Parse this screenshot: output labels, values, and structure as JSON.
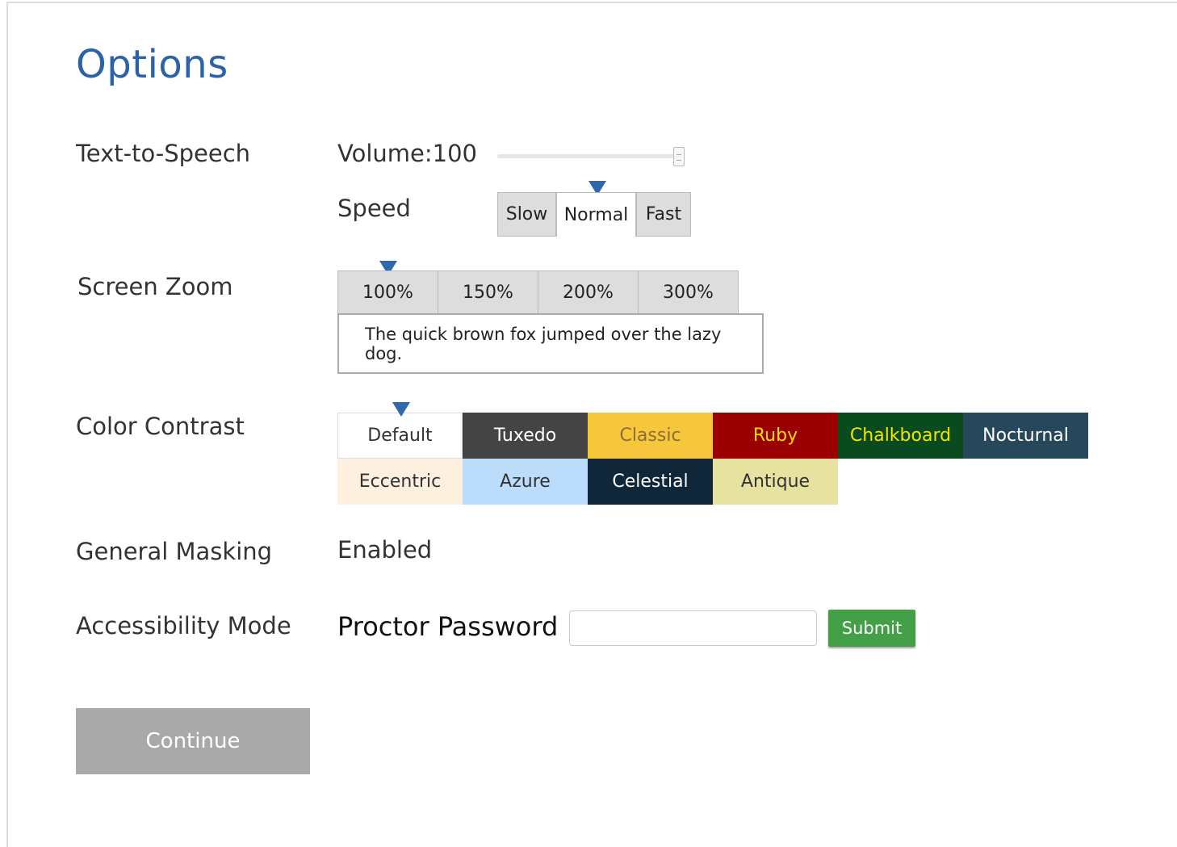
{
  "page": {
    "title": "Options"
  },
  "tts": {
    "label": "Text-to-Speech",
    "volume_label": "Volume:100",
    "volume_value": 100,
    "speed_label": "Speed",
    "speed_options": [
      "Slow",
      "Normal",
      "Fast"
    ],
    "speed_selected": "Normal"
  },
  "zoom": {
    "label": "Screen Zoom",
    "options": [
      "100%",
      "150%",
      "200%",
      "300%"
    ],
    "selected": "100%",
    "sample_text": "The quick brown fox jumped over the lazy dog."
  },
  "contrast": {
    "label": "Color Contrast",
    "selected": "Default",
    "themes": [
      {
        "name": "Default",
        "bg": "#ffffff",
        "fg": "#333333"
      },
      {
        "name": "Tuxedo",
        "bg": "#444444",
        "fg": "#ffffff"
      },
      {
        "name": "Classic",
        "bg": "#f6c73b",
        "fg": "#8a6d3b"
      },
      {
        "name": "Ruby",
        "bg": "#9b0000",
        "fg": "#ffdd00"
      },
      {
        "name": "Chalkboard",
        "bg": "#094a1e",
        "fg": "#f2e400"
      },
      {
        "name": "Nocturnal",
        "bg": "#27485a",
        "fg": "#ffffff"
      },
      {
        "name": "Eccentric",
        "bg": "#fdf0df",
        "fg": "#333333"
      },
      {
        "name": "Azure",
        "bg": "#bcdcfc",
        "fg": "#333333"
      },
      {
        "name": "Celestial",
        "bg": "#10273a",
        "fg": "#ffffff"
      },
      {
        "name": "Antique",
        "bg": "#e8e2a0",
        "fg": "#333333"
      }
    ]
  },
  "masking": {
    "label": "General Masking",
    "value": "Enabled"
  },
  "accessibility": {
    "label": "Accessibility Mode",
    "password_label": "Proctor Password",
    "password_value": "",
    "submit_label": "Submit"
  },
  "continue_label": "Continue",
  "colors": {
    "title": "#2b62a8",
    "pointer": "#2f68ad",
    "submit": "#43a047",
    "continue": "#a9a9a9"
  }
}
